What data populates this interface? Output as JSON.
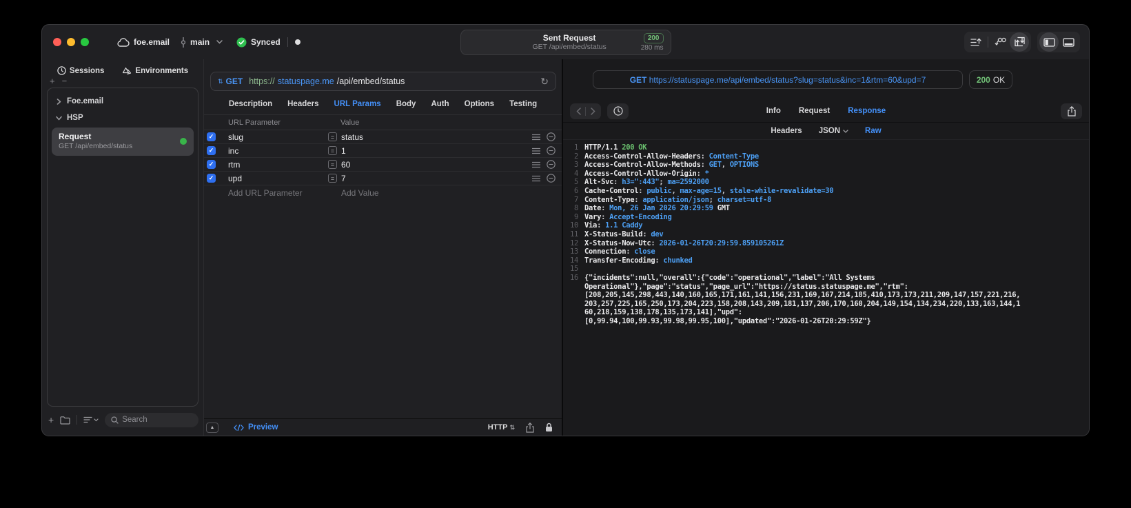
{
  "titlebar": {
    "project": "foe.email",
    "branch": "main",
    "sync_label": "Synced",
    "request_title": "Sent Request",
    "request_subtitle": "GET /api/embed/status",
    "status_badge": "200",
    "duration": "280 ms"
  },
  "sidebar": {
    "tabs": [
      {
        "label": "Sessions"
      },
      {
        "label": "Environments"
      }
    ],
    "groups": [
      {
        "label": "Foe.email",
        "expanded": false
      },
      {
        "label": "HSP",
        "expanded": true
      }
    ],
    "request_item": {
      "title": "Request",
      "subtitle": "GET /api/embed/status"
    },
    "search_placeholder": "Search"
  },
  "request_editor": {
    "method": "GET",
    "url_scheme": "https://",
    "url_host": "statuspage.me",
    "url_path": "/api/embed/status",
    "tabs": [
      "Description",
      "Headers",
      "URL Params",
      "Body",
      "Auth",
      "Options",
      "Testing"
    ],
    "active_tab": "URL Params",
    "params_columns": [
      "URL Parameter",
      "Value"
    ],
    "params_rows": [
      {
        "name": "slug",
        "value": "status",
        "checked": true
      },
      {
        "name": "inc",
        "value": "1",
        "checked": true
      },
      {
        "name": "rtm",
        "value": "60",
        "checked": true
      },
      {
        "name": "upd",
        "value": "7",
        "checked": true
      }
    ],
    "add_param_placeholder": "Add URL Parameter",
    "add_value_placeholder": "Add Value",
    "preview_label": "Preview",
    "protocol_label": "HTTP"
  },
  "response_panel": {
    "request_method": "GET",
    "request_url": "https://statuspage.me/api/embed/status?slug=status&inc=1&rtm=60&upd=7",
    "status_code": "200",
    "status_text": "OK",
    "tabs": [
      "Info",
      "Request",
      "Response"
    ],
    "active_tab": "Response",
    "subtabs": [
      {
        "label": "Headers"
      },
      {
        "label": "JSON",
        "dropdown": true
      },
      {
        "label": "Raw"
      }
    ],
    "active_subtab": "Raw",
    "raw_lines": [
      {
        "n": "1",
        "parts": [
          {
            "t": "HTTP/1.1 ",
            "c": "h"
          },
          {
            "t": "200 OK",
            "c": "g"
          }
        ]
      },
      {
        "n": "2",
        "parts": [
          {
            "t": "Access-Control-Allow-Headers",
            "c": "h"
          },
          {
            "t": ": ",
            "c": "p"
          },
          {
            "t": "Content-Type",
            "c": "v"
          }
        ]
      },
      {
        "n": "3",
        "parts": [
          {
            "t": "Access-Control-Allow-Methods",
            "c": "h"
          },
          {
            "t": ": ",
            "c": "p"
          },
          {
            "t": "GET",
            "c": "v"
          },
          {
            "t": ", ",
            "c": "p"
          },
          {
            "t": "OPTIONS",
            "c": "v"
          }
        ]
      },
      {
        "n": "4",
        "parts": [
          {
            "t": "Access-Control-Allow-Origin",
            "c": "h"
          },
          {
            "t": ": ",
            "c": "p"
          },
          {
            "t": "*",
            "c": "v"
          }
        ]
      },
      {
        "n": "5",
        "parts": [
          {
            "t": "Alt-Svc",
            "c": "h"
          },
          {
            "t": ": ",
            "c": "p"
          },
          {
            "t": "h3=\":443\"",
            "c": "v"
          },
          {
            "t": "; ",
            "c": "p"
          },
          {
            "t": "ma=2592000",
            "c": "v"
          }
        ]
      },
      {
        "n": "6",
        "parts": [
          {
            "t": "Cache-Control",
            "c": "h"
          },
          {
            "t": ": ",
            "c": "p"
          },
          {
            "t": "public",
            "c": "v"
          },
          {
            "t": ", ",
            "c": "p"
          },
          {
            "t": "max-age=15",
            "c": "v"
          },
          {
            "t": ", ",
            "c": "p"
          },
          {
            "t": "stale-while-revalidate=30",
            "c": "v"
          }
        ]
      },
      {
        "n": "7",
        "parts": [
          {
            "t": "Content-Type",
            "c": "h"
          },
          {
            "t": ": ",
            "c": "p"
          },
          {
            "t": "application/json",
            "c": "v"
          },
          {
            "t": "; ",
            "c": "p"
          },
          {
            "t": "charset=utf-8",
            "c": "v"
          }
        ]
      },
      {
        "n": "8",
        "parts": [
          {
            "t": "Date",
            "c": "h"
          },
          {
            "t": ": ",
            "c": "p"
          },
          {
            "t": "Mon, 26 Jan 2026 20:29:59",
            "c": "v"
          },
          {
            "t": " GMT",
            "c": "h"
          }
        ]
      },
      {
        "n": "9",
        "parts": [
          {
            "t": "Vary",
            "c": "h"
          },
          {
            "t": ": ",
            "c": "p"
          },
          {
            "t": "Accept-Encoding",
            "c": "v"
          }
        ]
      },
      {
        "n": "10",
        "parts": [
          {
            "t": "Via",
            "c": "h"
          },
          {
            "t": ": ",
            "c": "p"
          },
          {
            "t": "1.1 Caddy",
            "c": "v"
          }
        ]
      },
      {
        "n": "11",
        "parts": [
          {
            "t": "X-Status-Build",
            "c": "h"
          },
          {
            "t": ": ",
            "c": "p"
          },
          {
            "t": "dev",
            "c": "v"
          }
        ]
      },
      {
        "n": "12",
        "parts": [
          {
            "t": "X-Status-Now-Utc",
            "c": "h"
          },
          {
            "t": ": ",
            "c": "p"
          },
          {
            "t": "2026-01-26T20:29:59.859105261Z",
            "c": "v"
          }
        ]
      },
      {
        "n": "13",
        "parts": [
          {
            "t": "Connection",
            "c": "h"
          },
          {
            "t": ": ",
            "c": "p"
          },
          {
            "t": "close",
            "c": "v"
          }
        ]
      },
      {
        "n": "14",
        "parts": [
          {
            "t": "Transfer-Encoding",
            "c": "h"
          },
          {
            "t": ": ",
            "c": "p"
          },
          {
            "t": "chunked",
            "c": "v"
          }
        ]
      },
      {
        "n": "15",
        "parts": []
      },
      {
        "n": "16",
        "parts": [
          {
            "t": "{\"incidents\":null,\"overall\":{\"code\":\"operational\",\"label\":\"All Systems",
            "c": "b"
          }
        ]
      },
      {
        "n": "",
        "parts": [
          {
            "t": "Operational\"},\"page\":\"status\",\"page_url\":\"https://status.statuspage.me\",\"rtm\":",
            "c": "b"
          }
        ]
      },
      {
        "n": "",
        "parts": [
          {
            "t": "[208,205,145,298,443,140,160,165,171,161,141,156,231,169,167,214,185,410,173,173,211,209,147,157,221,216,",
            "c": "b"
          }
        ]
      },
      {
        "n": "",
        "parts": [
          {
            "t": "203,257,225,165,250,173,204,223,158,208,143,209,181,137,206,170,160,204,149,154,134,234,220,133,163,144,1",
            "c": "b"
          }
        ]
      },
      {
        "n": "",
        "parts": [
          {
            "t": "60,218,159,138,178,135,173,141],\"upd\":",
            "c": "b"
          }
        ]
      },
      {
        "n": "",
        "parts": [
          {
            "t": "[0,99.94,100,99.93,99.98,99.95,100],\"updated\":\"2026-01-26T20:29:59Z\"}",
            "c": "b"
          }
        ]
      }
    ]
  },
  "colors": {
    "accent_blue": "#4490f8",
    "status_green": "#6fc173",
    "checkbox_blue": "#2e6ff0",
    "sync_green": "#2fbf4f",
    "traffic_red": "#ff5f57",
    "traffic_yellow": "#febc2e",
    "traffic_green": "#28c840"
  }
}
